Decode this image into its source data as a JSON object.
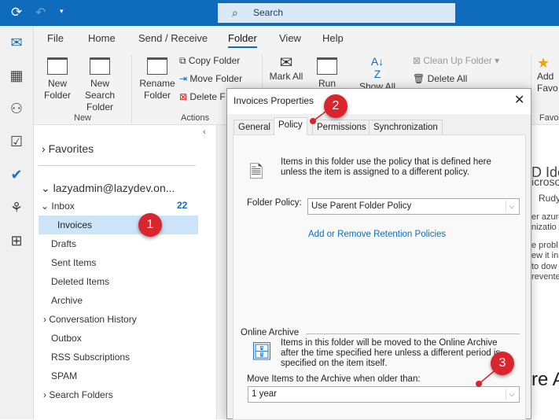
{
  "titlebar": {
    "search_placeholder": "Search"
  },
  "ribbon": {
    "tabs": [
      "File",
      "Home",
      "Send / Receive",
      "Folder",
      "View",
      "Help"
    ],
    "active_tab": "Folder",
    "new_folder": [
      "New",
      "Folder"
    ],
    "new_search_folder": [
      "New Search",
      "Folder"
    ],
    "group_new": "New",
    "rename_folder": [
      "Rename",
      "Folder"
    ],
    "copy_folder": "Copy Folder",
    "move_folder": "Move Folder",
    "delete_folder": "Delete F",
    "group_actions": "Actions",
    "mark_all": "Mark All",
    "run_rules": "Run Rules",
    "show_all": "Show All",
    "clean_up_folder": "Clean Up Folder",
    "delete_all": "Delete All",
    "add_favorites": [
      "Add",
      "Favo"
    ],
    "group_favorites": "Favo"
  },
  "folders": {
    "favorites": "Favorites",
    "account": "lazyadmin@lazydev.on...",
    "inbox": "Inbox",
    "inbox_count": "22",
    "items": [
      "Invoices",
      "Drafts",
      "Sent Items",
      "Deleted Items",
      "Archive",
      "Conversation History",
      "Outbox",
      "RSS Subscriptions",
      "SPAM",
      "Search Folders"
    ],
    "selected": "Invoices"
  },
  "reading": {
    "lines": [
      "D Ide",
      "icroso",
      "Rudy",
      "er azure",
      "nizatio",
      "e probl",
      "ew it in",
      "to dow",
      "revente",
      "re A"
    ]
  },
  "dialog": {
    "title": "Invoices Properties",
    "tabs": [
      "General",
      "Policy",
      "Permissions",
      "Synchronization"
    ],
    "active_tab": "Policy",
    "policy_desc": "Items in this folder use the policy that is defined here unless the item is assigned to a different policy.",
    "folder_policy_label": "Folder Policy:",
    "folder_policy_value": "Use Parent Folder Policy",
    "retention_link": "Add or Remove Retention Policies",
    "online_archive_header": "Online Archive",
    "archive_desc": "Items in this folder will be moved to the Online Archive after the time specified here unless a different period is specified on the item itself.",
    "archive_label": "Move Items to the Archive when older than:",
    "archive_value": "1 year"
  },
  "annotations": [
    "1",
    "2",
    "3"
  ],
  "colors": {
    "brand": "#0f6cbd",
    "selected": "#cce4f7",
    "badge": "#d9262e",
    "link": "#0f6cbd"
  }
}
